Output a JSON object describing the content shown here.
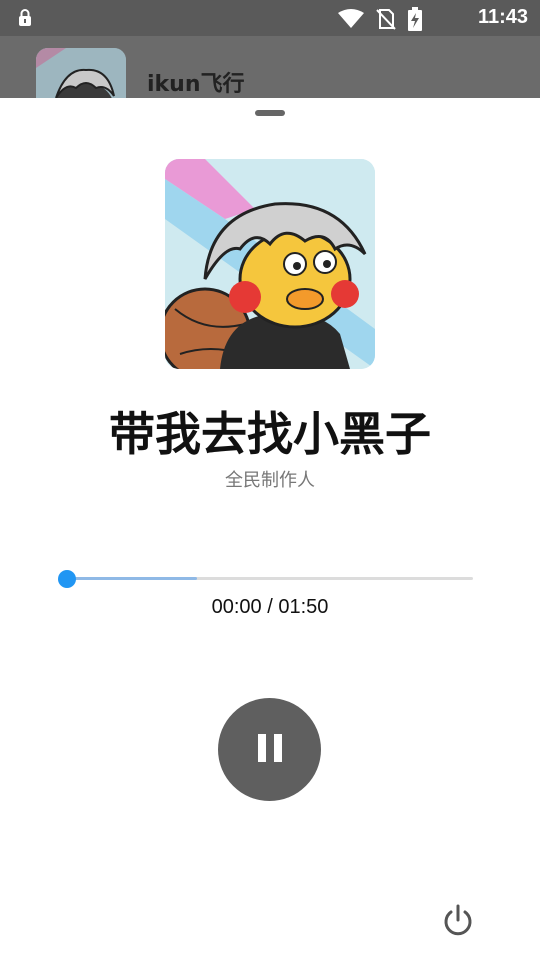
{
  "status_bar": {
    "time": "11:43"
  },
  "background_app": {
    "title": "ikun飞行"
  },
  "player": {
    "song_title": "带我去找小黑子",
    "artist": "全民制作人",
    "current_time": "00:00",
    "separator": "/",
    "total_time": "01:50",
    "progress_fraction": 0,
    "buffered_fraction": 0.32
  },
  "colors": {
    "accent": "#2196f3",
    "buffer": "#8fb9e6",
    "play_button": "#5f5f5f"
  },
  "icons": [
    "lock-icon",
    "wifi-icon",
    "no-sim-icon",
    "battery-charging-icon",
    "pause-icon",
    "power-icon"
  ]
}
